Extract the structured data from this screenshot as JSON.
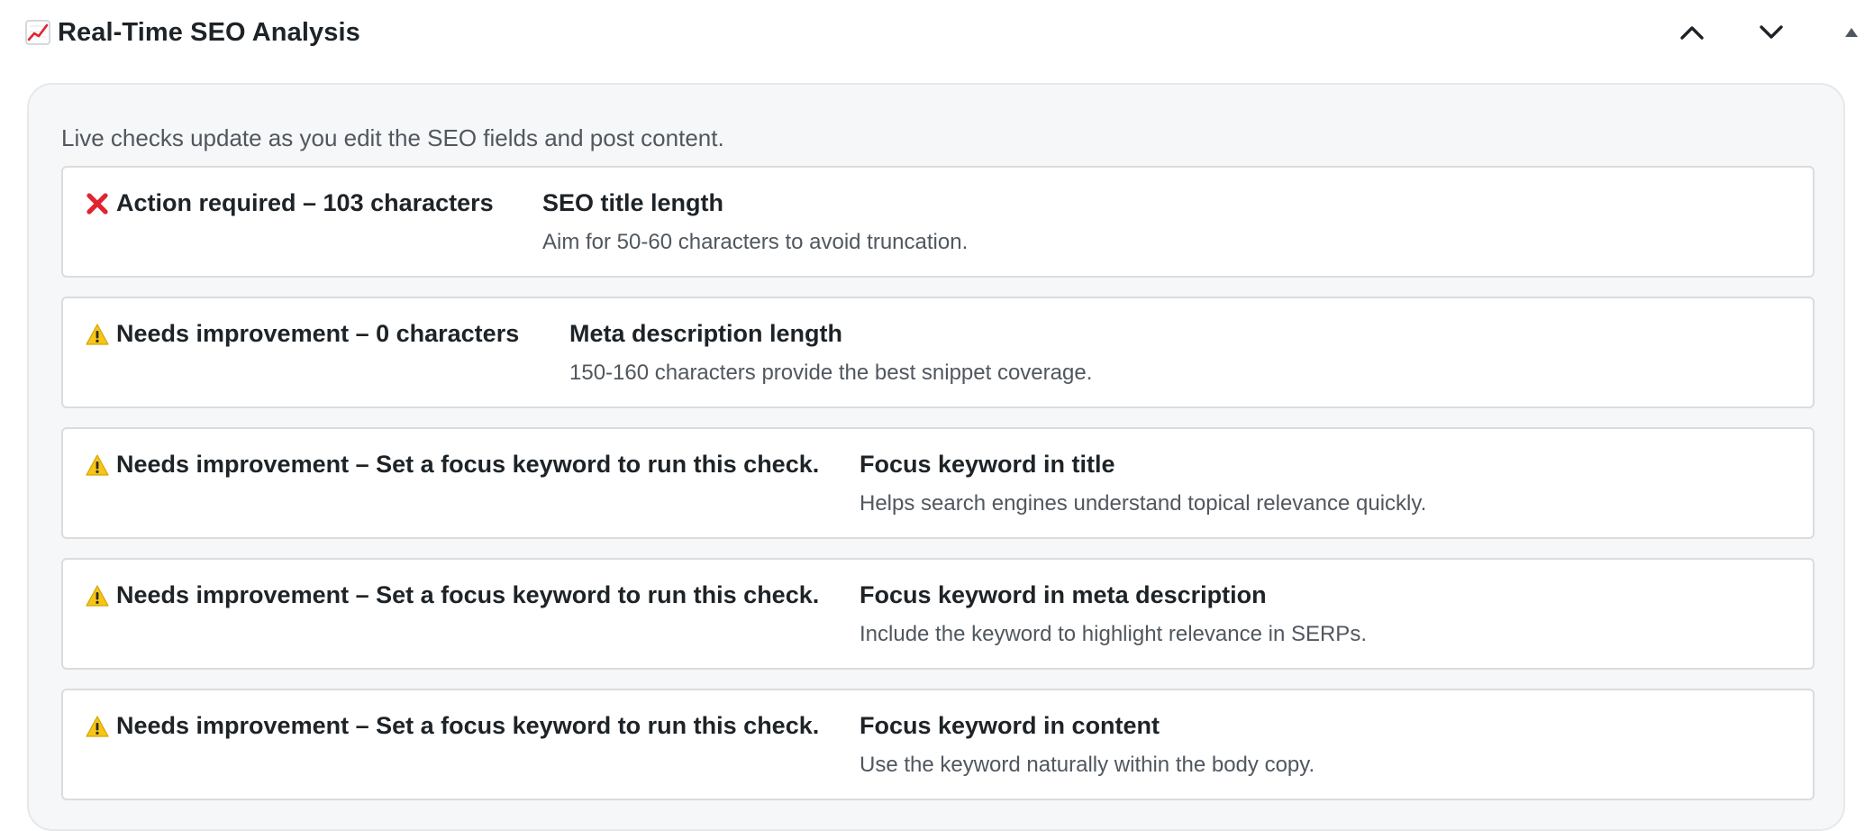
{
  "header": {
    "icon": "chart-increasing-icon",
    "title": "Real-Time SEO Analysis",
    "move_up_icon": "chevron-up-icon",
    "move_down_icon": "chevron-down-icon",
    "toggle_icon": "triangle-up-icon"
  },
  "panel": {
    "intro": "Live checks update as you edit the SEO fields and post content."
  },
  "checks": [
    {
      "status_icon": "cross-mark-icon",
      "status": "Action required – 103 characters",
      "title": "SEO title length",
      "description": "Aim for 50-60 characters to avoid truncation."
    },
    {
      "status_icon": "warning-icon",
      "status": "Needs improvement – 0 characters",
      "title": "Meta description length",
      "description": "150-160 characters provide the best snippet coverage."
    },
    {
      "status_icon": "warning-icon",
      "status": "Needs improvement – Set a focus keyword to run this check.",
      "title": "Focus keyword in title",
      "description": "Helps search engines understand topical relevance quickly."
    },
    {
      "status_icon": "warning-icon",
      "status": "Needs improvement – Set a focus keyword to run this check.",
      "title": "Focus keyword in meta description",
      "description": "Include the keyword to highlight relevance in SERPs."
    },
    {
      "status_icon": "warning-icon",
      "status": "Needs improvement – Set a focus keyword to run this check.",
      "title": "Focus keyword in content",
      "description": "Use the keyword naturally within the body copy."
    }
  ],
  "colors": {
    "error": "#e0242f",
    "warning": "#f5c518",
    "text": "#1d2327",
    "muted": "#50575e",
    "panel_bg": "#f6f7f9",
    "border": "#dcdcde"
  }
}
